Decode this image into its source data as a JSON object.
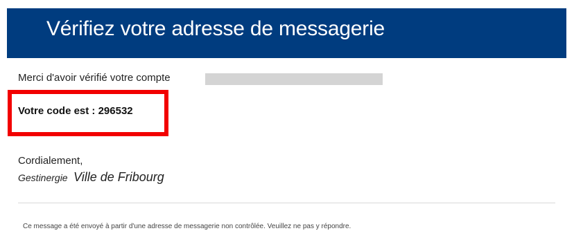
{
  "header": {
    "title": "Vérifiez votre adresse de messagerie",
    "background_color": "#003c7f"
  },
  "body": {
    "thanks_text": "Merci d'avoir vérifié votre compte",
    "code_line": "Votre code est : 296532",
    "highlight_color": "#f20000",
    "regards": "Cordialement,",
    "signature_org": "Gestinergie",
    "signature_city": "Ville de Fribourg"
  },
  "footer": {
    "note": "Ce message a été envoyé à partir d'une adresse de messagerie non contrôlée. Veuillez ne pas y répondre."
  }
}
